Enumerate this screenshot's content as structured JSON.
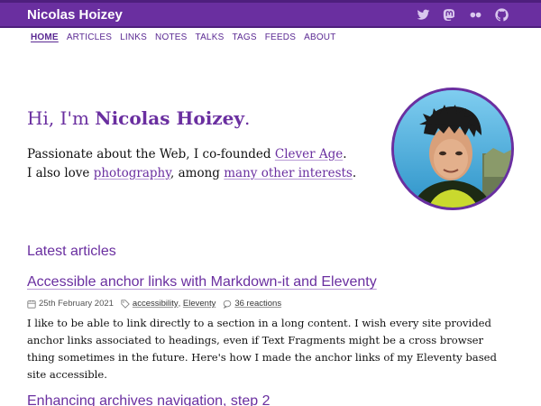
{
  "header": {
    "title": "Nicolas Hoizey",
    "social_icons": [
      "twitter-icon",
      "mastodon-icon",
      "flickr-icon",
      "github-icon"
    ],
    "bar_color": "#6a2fa0"
  },
  "nav": {
    "items": [
      "HOME",
      "ARTICLES",
      "LINKS",
      "NOTES",
      "TALKS",
      "TAGS",
      "FEEDS",
      "ABOUT"
    ],
    "active": "HOME"
  },
  "hero": {
    "greeting": "Hi, I'm",
    "name": "Nicolas Hoizey",
    "period": ".",
    "line1_prefix": "Passionate about the Web, I co-founded",
    "line1_link": "Clever Age",
    "line1_suffix": ".",
    "line2_prefix": "I also love",
    "line2_link1": "photography",
    "line2_middle": ", among",
    "line2_link2": "many other interests",
    "line2_suffix": "."
  },
  "latest": {
    "heading": "Latest articles",
    "articles": [
      {
        "title": "Accessible anchor links with Markdown-it and Eleventy",
        "date": "25th February 2021",
        "tags": [
          "accessibility",
          "Eleventy"
        ],
        "tag_separator": ",",
        "reactions": "36 reactions",
        "excerpt": "I like to be able to link directly to a section in a long content. I wish every site provided anchor links associated to headings, even if Text Fragments might be a cross browser thing sometimes in the future. Here's how I made the anchor links of my Eleventy based site accessible."
      },
      {
        "title": "Enhancing archives navigation, step 2"
      }
    ]
  },
  "colors": {
    "accent": "#6a2fa0",
    "text": "#111111"
  }
}
